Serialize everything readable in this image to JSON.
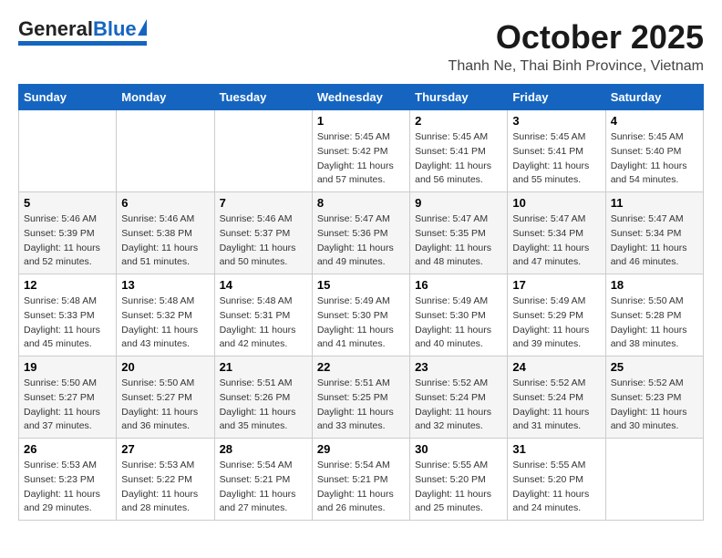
{
  "header": {
    "logo": {
      "general": "General",
      "blue": "Blue"
    },
    "month": "October 2025",
    "location": "Thanh Ne, Thai Binh Province, Vietnam"
  },
  "weekdays": [
    "Sunday",
    "Monday",
    "Tuesday",
    "Wednesday",
    "Thursday",
    "Friday",
    "Saturday"
  ],
  "weeks": [
    [
      {
        "day": "",
        "info": ""
      },
      {
        "day": "",
        "info": ""
      },
      {
        "day": "",
        "info": ""
      },
      {
        "day": "1",
        "info": "Sunrise: 5:45 AM\nSunset: 5:42 PM\nDaylight: 11 hours\nand 57 minutes."
      },
      {
        "day": "2",
        "info": "Sunrise: 5:45 AM\nSunset: 5:41 PM\nDaylight: 11 hours\nand 56 minutes."
      },
      {
        "day": "3",
        "info": "Sunrise: 5:45 AM\nSunset: 5:41 PM\nDaylight: 11 hours\nand 55 minutes."
      },
      {
        "day": "4",
        "info": "Sunrise: 5:45 AM\nSunset: 5:40 PM\nDaylight: 11 hours\nand 54 minutes."
      }
    ],
    [
      {
        "day": "5",
        "info": "Sunrise: 5:46 AM\nSunset: 5:39 PM\nDaylight: 11 hours\nand 52 minutes."
      },
      {
        "day": "6",
        "info": "Sunrise: 5:46 AM\nSunset: 5:38 PM\nDaylight: 11 hours\nand 51 minutes."
      },
      {
        "day": "7",
        "info": "Sunrise: 5:46 AM\nSunset: 5:37 PM\nDaylight: 11 hours\nand 50 minutes."
      },
      {
        "day": "8",
        "info": "Sunrise: 5:47 AM\nSunset: 5:36 PM\nDaylight: 11 hours\nand 49 minutes."
      },
      {
        "day": "9",
        "info": "Sunrise: 5:47 AM\nSunset: 5:35 PM\nDaylight: 11 hours\nand 48 minutes."
      },
      {
        "day": "10",
        "info": "Sunrise: 5:47 AM\nSunset: 5:34 PM\nDaylight: 11 hours\nand 47 minutes."
      },
      {
        "day": "11",
        "info": "Sunrise: 5:47 AM\nSunset: 5:34 PM\nDaylight: 11 hours\nand 46 minutes."
      }
    ],
    [
      {
        "day": "12",
        "info": "Sunrise: 5:48 AM\nSunset: 5:33 PM\nDaylight: 11 hours\nand 45 minutes."
      },
      {
        "day": "13",
        "info": "Sunrise: 5:48 AM\nSunset: 5:32 PM\nDaylight: 11 hours\nand 43 minutes."
      },
      {
        "day": "14",
        "info": "Sunrise: 5:48 AM\nSunset: 5:31 PM\nDaylight: 11 hours\nand 42 minutes."
      },
      {
        "day": "15",
        "info": "Sunrise: 5:49 AM\nSunset: 5:30 PM\nDaylight: 11 hours\nand 41 minutes."
      },
      {
        "day": "16",
        "info": "Sunrise: 5:49 AM\nSunset: 5:30 PM\nDaylight: 11 hours\nand 40 minutes."
      },
      {
        "day": "17",
        "info": "Sunrise: 5:49 AM\nSunset: 5:29 PM\nDaylight: 11 hours\nand 39 minutes."
      },
      {
        "day": "18",
        "info": "Sunrise: 5:50 AM\nSunset: 5:28 PM\nDaylight: 11 hours\nand 38 minutes."
      }
    ],
    [
      {
        "day": "19",
        "info": "Sunrise: 5:50 AM\nSunset: 5:27 PM\nDaylight: 11 hours\nand 37 minutes."
      },
      {
        "day": "20",
        "info": "Sunrise: 5:50 AM\nSunset: 5:27 PM\nDaylight: 11 hours\nand 36 minutes."
      },
      {
        "day": "21",
        "info": "Sunrise: 5:51 AM\nSunset: 5:26 PM\nDaylight: 11 hours\nand 35 minutes."
      },
      {
        "day": "22",
        "info": "Sunrise: 5:51 AM\nSunset: 5:25 PM\nDaylight: 11 hours\nand 33 minutes."
      },
      {
        "day": "23",
        "info": "Sunrise: 5:52 AM\nSunset: 5:24 PM\nDaylight: 11 hours\nand 32 minutes."
      },
      {
        "day": "24",
        "info": "Sunrise: 5:52 AM\nSunset: 5:24 PM\nDaylight: 11 hours\nand 31 minutes."
      },
      {
        "day": "25",
        "info": "Sunrise: 5:52 AM\nSunset: 5:23 PM\nDaylight: 11 hours\nand 30 minutes."
      }
    ],
    [
      {
        "day": "26",
        "info": "Sunrise: 5:53 AM\nSunset: 5:23 PM\nDaylight: 11 hours\nand 29 minutes."
      },
      {
        "day": "27",
        "info": "Sunrise: 5:53 AM\nSunset: 5:22 PM\nDaylight: 11 hours\nand 28 minutes."
      },
      {
        "day": "28",
        "info": "Sunrise: 5:54 AM\nSunset: 5:21 PM\nDaylight: 11 hours\nand 27 minutes."
      },
      {
        "day": "29",
        "info": "Sunrise: 5:54 AM\nSunset: 5:21 PM\nDaylight: 11 hours\nand 26 minutes."
      },
      {
        "day": "30",
        "info": "Sunrise: 5:55 AM\nSunset: 5:20 PM\nDaylight: 11 hours\nand 25 minutes."
      },
      {
        "day": "31",
        "info": "Sunrise: 5:55 AM\nSunset: 5:20 PM\nDaylight: 11 hours\nand 24 minutes."
      },
      {
        "day": "",
        "info": ""
      }
    ]
  ]
}
